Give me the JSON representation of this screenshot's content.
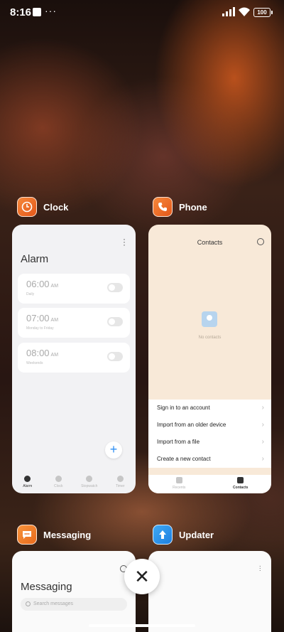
{
  "status_bar": {
    "time": "8:16",
    "overflow": "···",
    "battery": "100"
  },
  "recents": {
    "apps": [
      {
        "name": "Clock",
        "icon": "clock-icon",
        "preview": {
          "title": "Alarm",
          "alarms": [
            {
              "time": "06:00",
              "ampm": "AM",
              "sub": "Daily",
              "on": false
            },
            {
              "time": "07:00",
              "ampm": "AM",
              "sub": "Monday to Friday",
              "on": false
            },
            {
              "time": "08:00",
              "ampm": "AM",
              "sub": "Weekends",
              "on": false
            }
          ],
          "tabs": [
            "Alarm",
            "Clock",
            "Stopwatch",
            "Timer"
          ],
          "active_tab": "Alarm"
        }
      },
      {
        "name": "Phone",
        "icon": "phone-icon",
        "preview": {
          "title": "Contacts",
          "empty_text": "No contacts",
          "actions": [
            "Sign in to an account",
            "Import from an older device",
            "Import from a file",
            "Create a new contact"
          ],
          "tabs": [
            "Recents",
            "Contacts"
          ],
          "active_tab": "Contacts"
        }
      },
      {
        "name": "Messaging",
        "icon": "message-icon",
        "preview": {
          "title": "Messaging",
          "search_placeholder": "Search messages"
        }
      },
      {
        "name": "Updater",
        "icon": "updater-icon",
        "preview": {}
      }
    ]
  },
  "close_button": {
    "symbol": "✕"
  },
  "colors": {
    "accent_orange": "#e9661f",
    "updater_blue": "#2a8ff0",
    "fab_blue": "#2f8ff3"
  }
}
